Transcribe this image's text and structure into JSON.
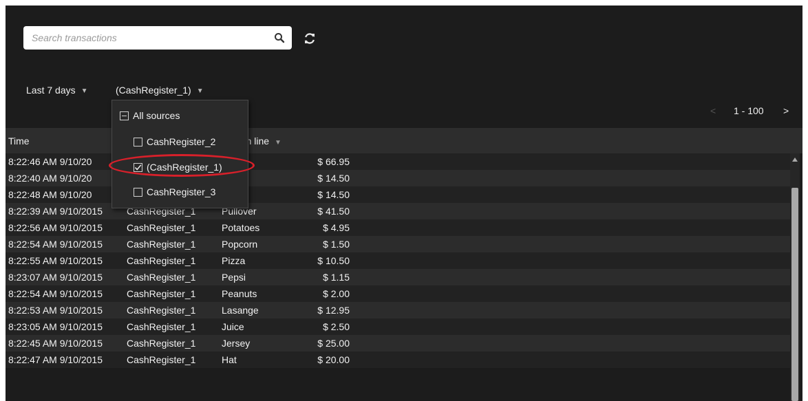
{
  "search": {
    "placeholder": "Search transactions"
  },
  "filters": {
    "time_range": "Last 7 days",
    "source": "(CashRegister_1)"
  },
  "pagination": {
    "prev": "<",
    "range": "1 - 100",
    "next": ">"
  },
  "table": {
    "columns": {
      "time": "Time",
      "transaction_line": "action line"
    },
    "rows": [
      {
        "time": "8:22:46 AM 9/10/20",
        "source": "",
        "item": "",
        "price": "$ 66.95"
      },
      {
        "time": "8:22:40 AM 9/10/20",
        "source": "",
        "item": "s",
        "price": "$ 14.50"
      },
      {
        "time": "8:22:48 AM 9/10/20",
        "source": "",
        "item": "s",
        "price": "$ 14.50"
      },
      {
        "time": "8:22:39 AM 9/10/2015",
        "source": "CashRegister_1",
        "item": "Pullover",
        "price": "$ 41.50"
      },
      {
        "time": "8:22:56 AM 9/10/2015",
        "source": "CashRegister_1",
        "item": "Potatoes",
        "price": "$ 4.95"
      },
      {
        "time": "8:22:54 AM 9/10/2015",
        "source": "CashRegister_1",
        "item": "Popcorn",
        "price": "$ 1.50"
      },
      {
        "time": "8:22:55 AM 9/10/2015",
        "source": "CashRegister_1",
        "item": "Pizza",
        "price": "$ 10.50"
      },
      {
        "time": "8:23:07 AM 9/10/2015",
        "source": "CashRegister_1",
        "item": "Pepsi",
        "price": "$ 1.15"
      },
      {
        "time": "8:22:54 AM 9/10/2015",
        "source": "CashRegister_1",
        "item": "Peanuts",
        "price": "$ 2.00"
      },
      {
        "time": "8:22:53 AM 9/10/2015",
        "source": "CashRegister_1",
        "item": "Lasange",
        "price": "$ 12.95"
      },
      {
        "time": "8:23:05 AM 9/10/2015",
        "source": "CashRegister_1",
        "item": "Juice",
        "price": "$ 2.50"
      },
      {
        "time": "8:22:45 AM 9/10/2015",
        "source": "CashRegister_1",
        "item": "Jersey",
        "price": "$ 25.00"
      },
      {
        "time": "8:22:47 AM 9/10/2015",
        "source": "CashRegister_1",
        "item": "Hat",
        "price": "$ 20.00"
      }
    ]
  },
  "source_dropdown": {
    "all_label": "All sources",
    "all_state": "partial",
    "options": [
      {
        "label": "CashRegister_2",
        "checked": false
      },
      {
        "label": "(CashRegister_1)",
        "checked": true
      },
      {
        "label": "CashRegister_3",
        "checked": false
      }
    ]
  },
  "colors": {
    "background": "#1c1c1c",
    "header": "#2d2d2d",
    "highlight": "#d8202a"
  },
  "icons": {
    "search": "search-icon",
    "refresh": "refresh-icon"
  }
}
